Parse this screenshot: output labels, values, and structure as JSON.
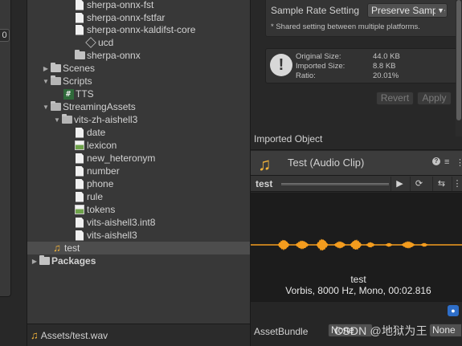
{
  "left_panel": {
    "badge": "0"
  },
  "tree": {
    "items": [
      {
        "label": "sherpa-onnx-fst",
        "icon": "doc-icon"
      },
      {
        "label": "sherpa-onnx-fstfar",
        "icon": "doc-icon"
      },
      {
        "label": "sherpa-onnx-kaldifst-core",
        "icon": "doc-icon"
      },
      {
        "label": "ucd",
        "icon": "folder-icon"
      },
      {
        "label": "sherpa-onnx",
        "icon": "folder-icon"
      },
      {
        "label": "Scenes",
        "icon": "folder-icon"
      },
      {
        "label": "Scripts",
        "icon": "folder-icon"
      },
      {
        "label": "TTS",
        "icon": "csharp-script-icon"
      },
      {
        "label": "StreamingAssets",
        "icon": "folder-icon"
      },
      {
        "label": "vits-zh-aishell3",
        "icon": "folder-icon"
      },
      {
        "label": "date",
        "icon": "doc-icon"
      },
      {
        "label": "lexicon",
        "icon": "image-icon"
      },
      {
        "label": "new_heteronym",
        "icon": "doc-icon"
      },
      {
        "label": "number",
        "icon": "doc-icon"
      },
      {
        "label": "phone",
        "icon": "doc-icon"
      },
      {
        "label": "rule",
        "icon": "doc-icon"
      },
      {
        "label": "tokens",
        "icon": "image-icon"
      },
      {
        "label": "vits-aishell3.int8",
        "icon": "doc-icon"
      },
      {
        "label": "vits-aishell3",
        "icon": "doc-icon"
      },
      {
        "label": "test",
        "icon": "audio-clip-icon",
        "selected": true
      },
      {
        "label": "Packages",
        "icon": "folder-icon"
      }
    ],
    "footer_path": "Assets/test.wav"
  },
  "inspector": {
    "sample_rate_label": "Sample Rate Setting",
    "sample_rate_value": "Preserve Sample Rate",
    "shared_note": "* Shared setting between multiple platforms.",
    "info": {
      "original_size_label": "Original Size:",
      "original_size_value": "44.0 KB",
      "imported_size_label": "Imported Size:",
      "imported_size_value": "8.8 KB",
      "ratio_label": "Ratio:",
      "ratio_value": "20.01%"
    },
    "revert_label": "Revert",
    "apply_label": "Apply",
    "imported_object_label": "Imported Object",
    "asset_title": "Test (Audio Clip)",
    "preview_name": "test",
    "wave_name": "test",
    "wave_info": "Vorbis, 8000 Hz, Mono, 00:02.816",
    "asset_bundle_label": "AssetBundle",
    "asset_bundle_value": "None",
    "asset_bundle_variant": "None",
    "watermark": "CSDN @地狱为王",
    "waveform_color": "#f39c1e"
  }
}
